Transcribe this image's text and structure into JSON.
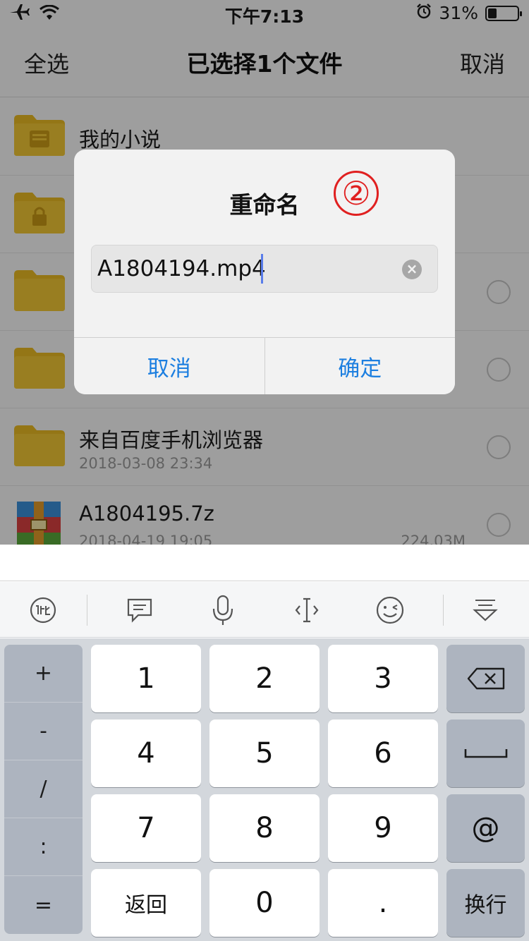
{
  "status_bar": {
    "time": "下午7:13",
    "battery_percent": "31%",
    "battery_level": 31,
    "icons": [
      "airplane-icon",
      "wifi-icon",
      "alarm-icon",
      "battery-icon"
    ]
  },
  "nav": {
    "select_all": "全选",
    "title": "已选择1个文件",
    "cancel": "取消"
  },
  "files": [
    {
      "name": "我的小说",
      "date": "",
      "size": "",
      "icon": "book-folder-icon",
      "has_radio": false
    },
    {
      "name": "",
      "date": "",
      "size": "",
      "icon": "lock-folder-icon",
      "has_radio": false
    },
    {
      "name": "",
      "date": "",
      "size": "",
      "icon": "folder-icon",
      "has_radio": true
    },
    {
      "name": "",
      "date": "",
      "size": "",
      "icon": "folder-icon",
      "has_radio": true
    },
    {
      "name": "来自百度手机浏览器",
      "date": "2018-03-08 23:34",
      "size": "",
      "icon": "folder-icon",
      "has_radio": true
    },
    {
      "name": "A1804195.7z",
      "date": "2018-04-19 19:05",
      "size": "224.03M",
      "icon": "archive-icon",
      "has_radio": true
    }
  ],
  "dialog": {
    "title": "重命名",
    "step_badge": "②",
    "input_value": "A1804194.mp4",
    "cancel_label": "取消",
    "confirm_label": "确定"
  },
  "keyboard": {
    "toolbar_icons": [
      "ime-logo-icon",
      "chat-bubble-icon",
      "microphone-icon",
      "cursor-move-icon",
      "emoji-icon",
      "hide-keyboard-icon"
    ],
    "side_keys": [
      "+",
      "-",
      "/",
      ":",
      "="
    ],
    "rows": [
      [
        "1",
        "2",
        "3"
      ],
      [
        "4",
        "5",
        "6"
      ],
      [
        "7",
        "8",
        "9"
      ],
      [
        "返回",
        "0",
        "."
      ]
    ],
    "right_keys": {
      "delete": "delete-icon",
      "space": "space-icon",
      "at": "@",
      "enter": "换行"
    }
  },
  "colors": {
    "accent_blue": "#1d7fe0",
    "folder_yellow": "#e8b923",
    "badge_red": "#e02020",
    "caret_blue": "#5a7dea"
  }
}
